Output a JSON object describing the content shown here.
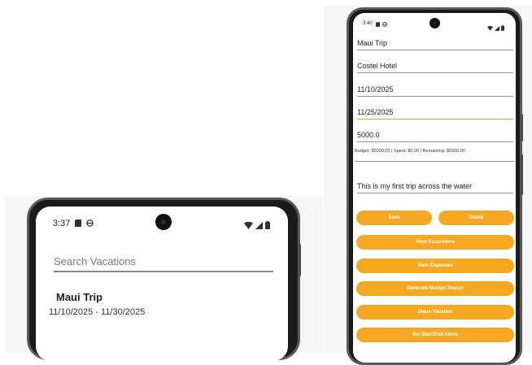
{
  "left_screen": {
    "status": {
      "time": "3:37"
    },
    "search": {
      "placeholder": "Search Vacations"
    },
    "vacations": [
      {
        "title": "Maui Trip",
        "dates": "11/10/2025 - 11/30/2025"
      }
    ]
  },
  "right_screen": {
    "status": {
      "time": "3:40"
    },
    "fields": {
      "title": "Maui Trip",
      "hotel": "Costel Hotel",
      "start_date": "11/10/2025",
      "end_date": "11/25/2025",
      "budget": "5000.0",
      "notes": "This is my first trip across the water"
    },
    "budget_summary": "Budget: $5000.00 | Spent: $0.00 | Remaining: $5000.00",
    "buttons": {
      "save": "Save",
      "delete": "Delete",
      "view_excursions": "View Excursions",
      "view_expenses": "View Expenses",
      "generate_report": "Generate Budget Report",
      "share": "Share Vacation",
      "alerts": "Set Start/End Alerts"
    }
  },
  "colors": {
    "accent": "#f7a823",
    "focus_underline": "#f2a516"
  },
  "icons": [
    "sim-card-icon",
    "privacy-icon",
    "wifi-icon",
    "signal-icon",
    "battery-icon"
  ]
}
